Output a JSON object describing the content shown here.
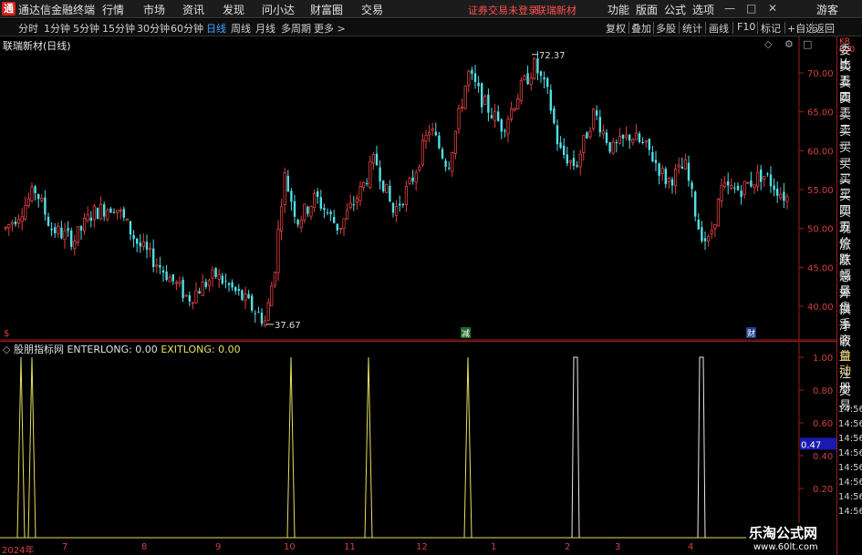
{
  "app": {
    "title": "通达信金融终端",
    "menus": [
      "行情",
      "市场",
      "资讯",
      "发现",
      "问小达",
      "财富圈",
      "交易"
    ],
    "notice": "证券交易未登录",
    "stock_name_top": "联瑞新材",
    "right_menus": [
      "功能",
      "版面",
      "公式",
      "选项"
    ],
    "user": "游客"
  },
  "toolbar": {
    "periods": [
      "分时",
      "1分钟",
      "5分钟",
      "15分钟",
      "30分钟",
      "60分钟",
      "日线",
      "周线",
      "月线",
      "多周期",
      "更多 >"
    ],
    "active_period": "日线",
    "tools": [
      "复权",
      "叠加",
      "多股",
      "统计",
      "画线",
      "F10",
      "标记",
      "+自选",
      "返回"
    ]
  },
  "chart": {
    "title": "联瑞新材(日线)",
    "price_labels": [
      "70.00",
      "65.00",
      "60.00",
      "55.00",
      "50.00",
      "45.00",
      "40.00"
    ],
    "high_label": "72.37",
    "low_label": "37.67",
    "event_markers": [
      "减",
      "财"
    ],
    "colors": {
      "up": "#e04040",
      "down": "#4fe0e6",
      "axis": "#9b1c1c"
    }
  },
  "indicator": {
    "name": "股朋指标网",
    "enter_label": "ENTERLONG: 0.00",
    "exit_label": "EXITLONG: 0.00",
    "y_labels": [
      "1.00",
      "0.80",
      "0.60",
      "0.40",
      "0.20"
    ],
    "current_value": "0.47"
  },
  "xaxis": {
    "labels": [
      "2024年",
      "7",
      "8",
      "9",
      "10",
      "11",
      "12",
      "1",
      "2",
      "3",
      "4"
    ]
  },
  "right_panel": {
    "labels_top": [
      "委比",
      "卖五",
      "卖四",
      "卖三",
      "卖二",
      "卖一",
      "买一",
      "买二",
      "买三",
      "买四",
      "买五",
      "现价",
      "涨跌",
      "涨幅",
      "总量",
      "外盘",
      "换手",
      "净资",
      "收益"
    ],
    "badge": "KR\n000",
    "labels_bottom": [
      "自动",
      "注册",
      "交易"
    ],
    "times": [
      "14:56",
      "14:56",
      "14:56",
      "14:56",
      "14:56",
      "14:56",
      "14:56",
      "14:56"
    ]
  },
  "watermark": {
    "title": "乐淘公式网",
    "url": "www.60lt.com"
  }
}
